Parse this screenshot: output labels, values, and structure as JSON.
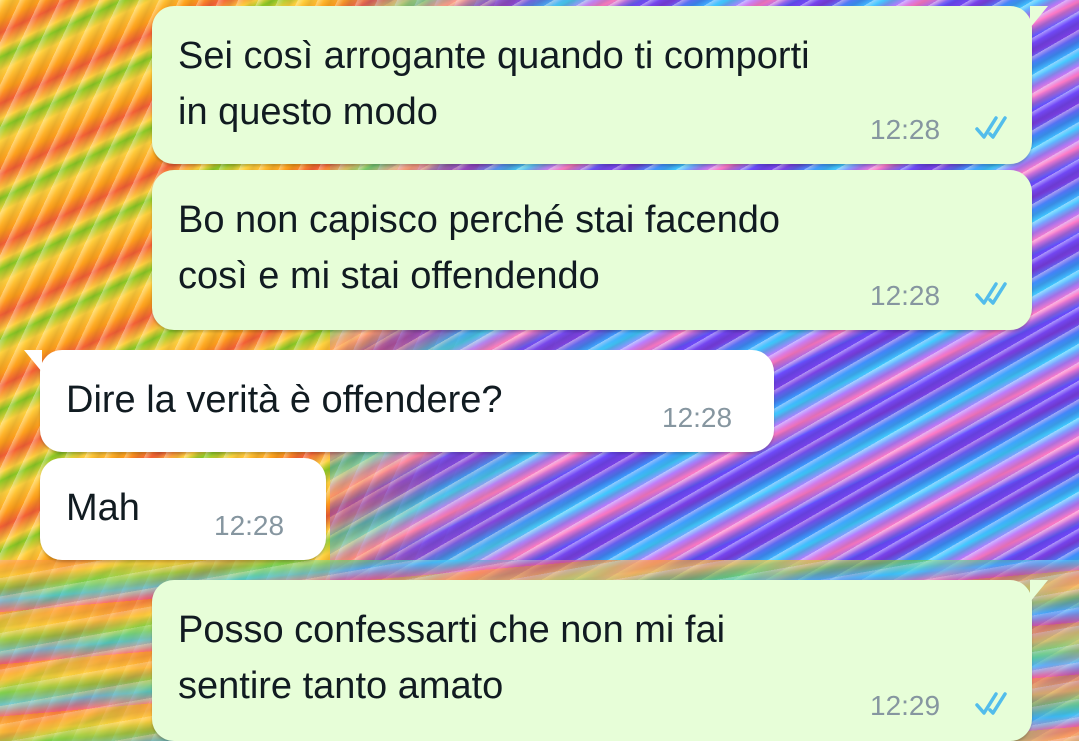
{
  "chat": {
    "messages": [
      {
        "direction": "outgoing",
        "text": "Sei così arrogante quando ti comporti\nin questo modo",
        "time": "12:28",
        "status": "read"
      },
      {
        "direction": "outgoing",
        "text": "Bo non capisco perché stai facendo\ncosì e mi stai offendendo",
        "time": "12:28",
        "status": "read"
      },
      {
        "direction": "incoming",
        "text": "Dire la verità è offendere?",
        "time": "12:28"
      },
      {
        "direction": "incoming",
        "text": "Mah",
        "time": "12:28"
      },
      {
        "direction": "outgoing",
        "text": "Posso confessarti che non mi fai\nsentire tanto amato",
        "time": "12:29",
        "status": "read"
      }
    ]
  },
  "colors": {
    "outgoing_bubble": "#e7fed8",
    "incoming_bubble": "#ffffff",
    "read_ticks": "#53bdeb",
    "timestamp": "#8696a0"
  },
  "icons": {
    "read_receipt": "double-check-icon"
  }
}
